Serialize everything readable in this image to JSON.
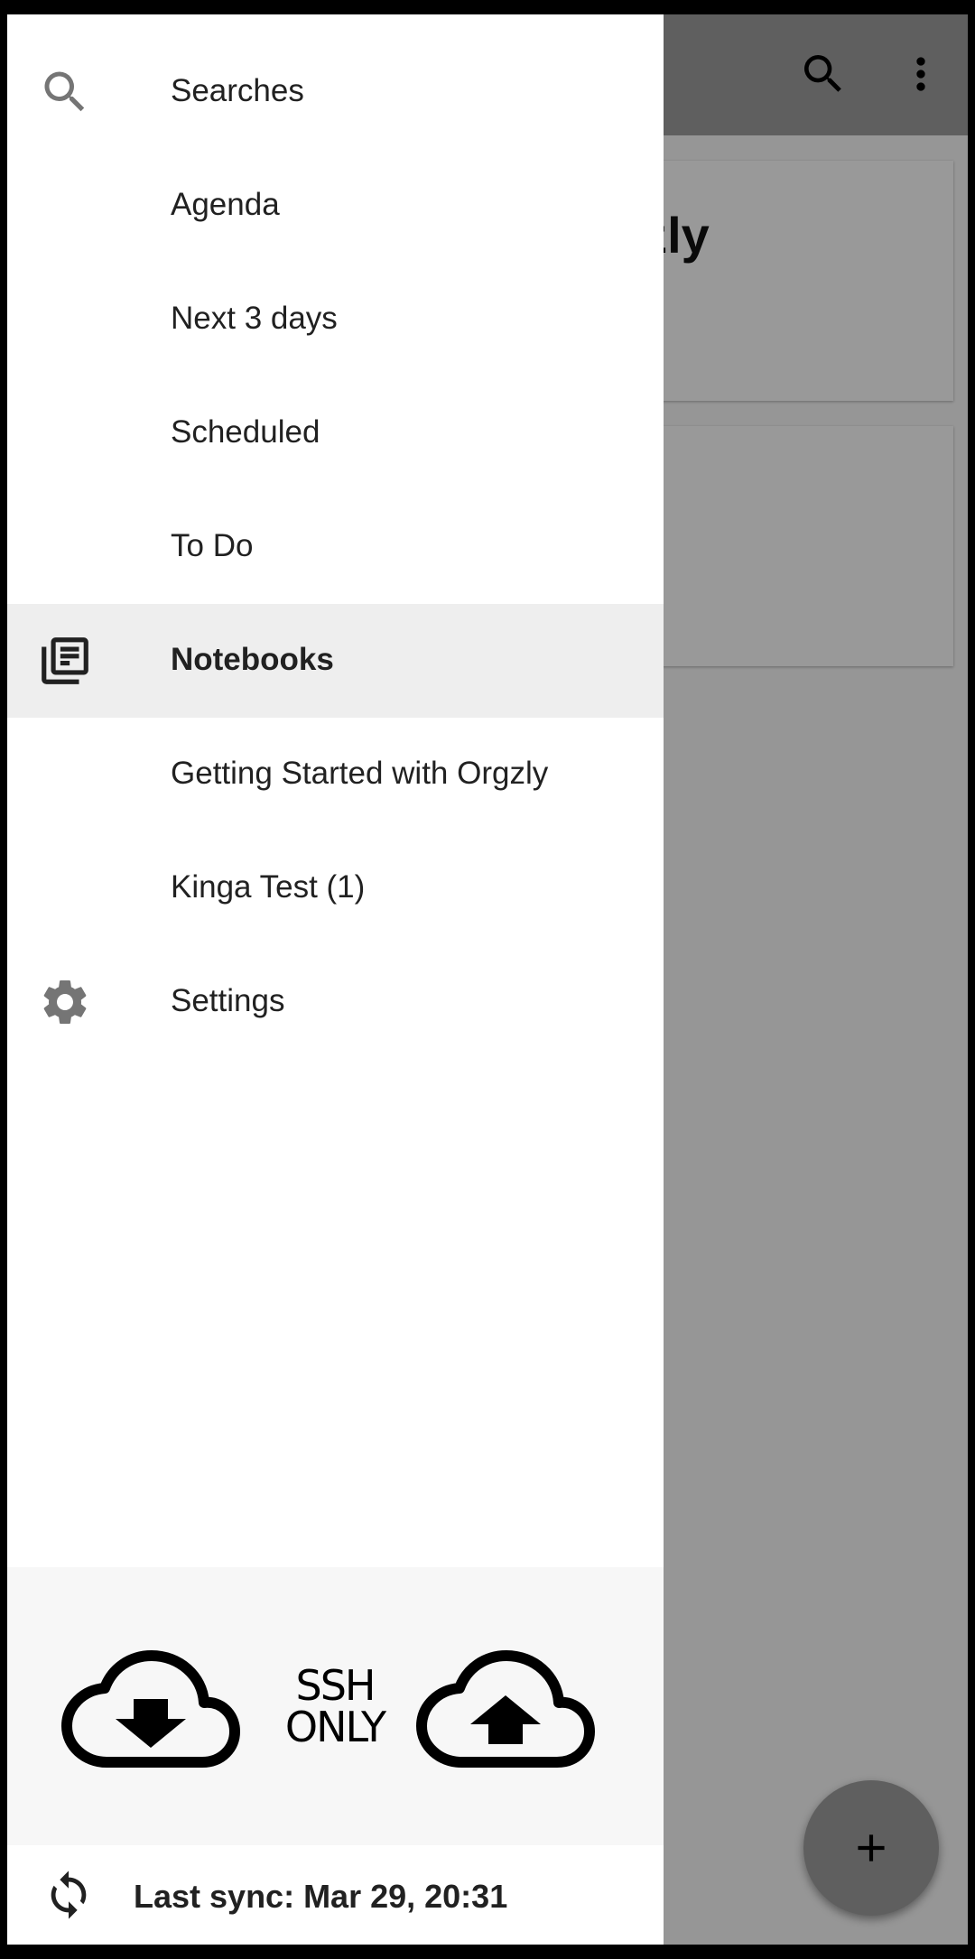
{
  "app": {
    "card_title_fragment": "ly"
  },
  "drawer": {
    "items": [
      {
        "label": "Searches",
        "icon": "search-icon"
      },
      {
        "label": "Agenda"
      },
      {
        "label": "Next 3 days"
      },
      {
        "label": "Scheduled"
      },
      {
        "label": "To Do"
      },
      {
        "label": "Notebooks",
        "icon": "notebooks-icon",
        "active": true
      },
      {
        "label": "Getting Started with Orgzly"
      },
      {
        "label": "Kinga Test (1)"
      },
      {
        "label": "Settings",
        "icon": "gear-icon"
      }
    ],
    "sync_panel": {
      "download_icon": "cloud-download-icon",
      "upload_icon": "cloud-upload-icon",
      "label_line1": "SSH",
      "label_line2": "ONLY"
    },
    "footer": {
      "icon": "sync-icon",
      "last_sync": "Last sync: Mar 29, 20:31"
    }
  },
  "colors": {
    "drawer_bg": "#ffffff",
    "active_item_bg": "#eeeeee",
    "scrim": "#626262"
  }
}
